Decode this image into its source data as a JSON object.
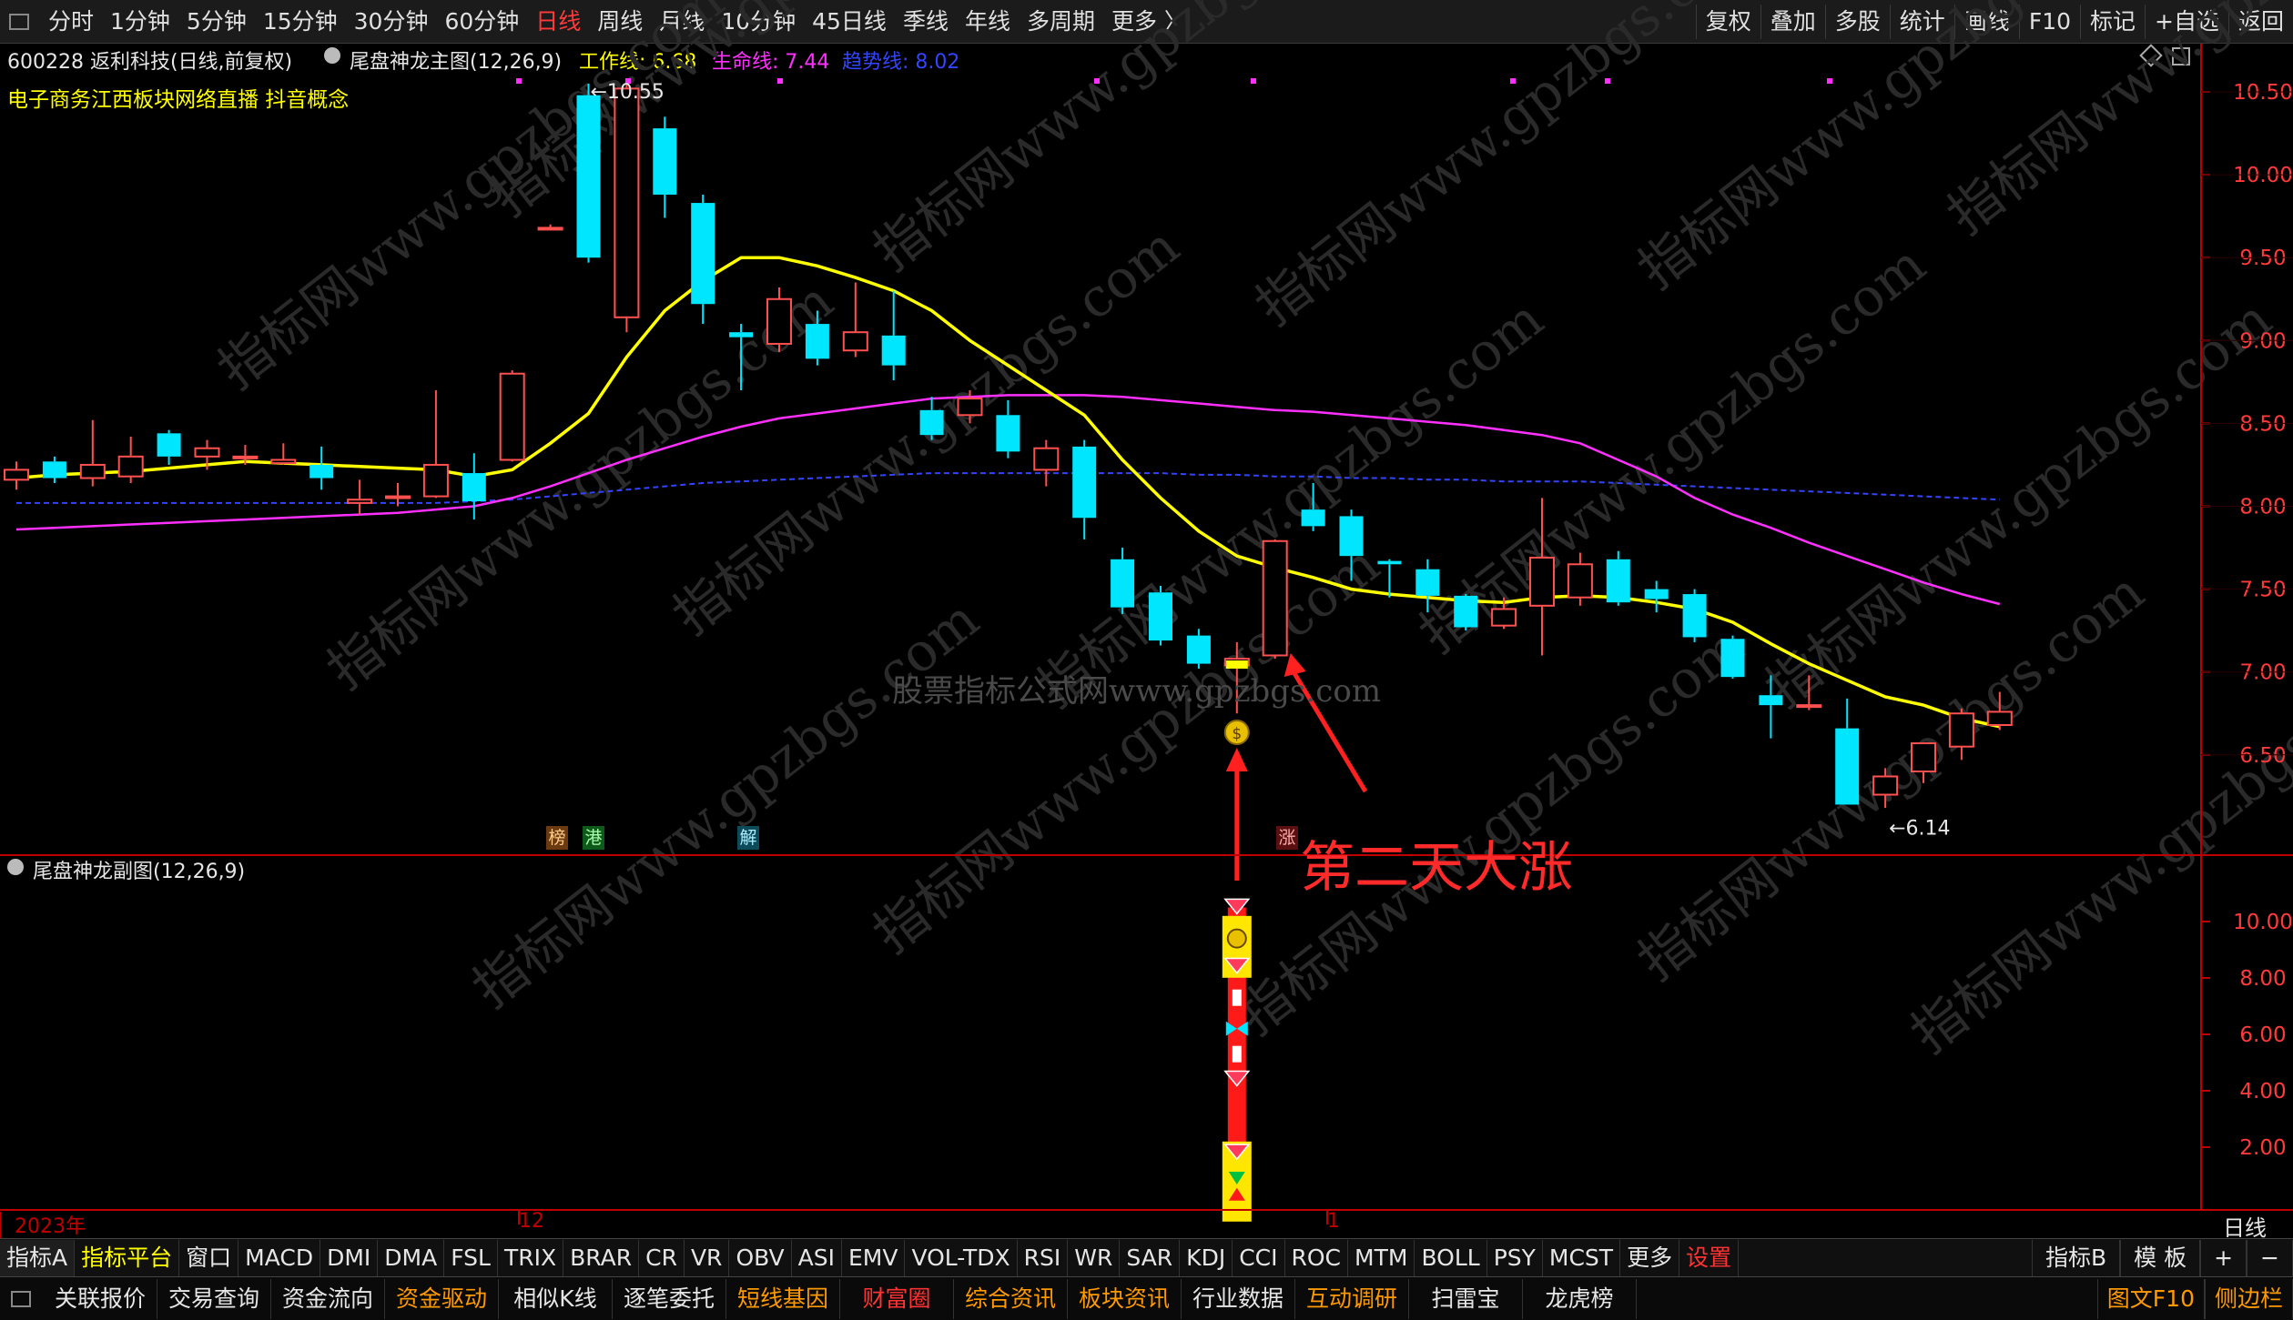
{
  "top_tabs": [
    "分时",
    "1分钟",
    "5分钟",
    "15分钟",
    "30分钟",
    "60分钟",
    "日线",
    "周线",
    "月线",
    "10分钟",
    "45日线",
    "季线",
    "年线",
    "多周期",
    "更多 〉"
  ],
  "top_active": "日线",
  "top_right": [
    "复权",
    "叠加",
    "多股",
    "统计",
    "画线",
    "F10",
    "标记",
    "+自选",
    "返回"
  ],
  "main_header": {
    "stock": "600228 返利科技(日线,前复权)",
    "indicator": "尾盘神龙主图(12,26,9)",
    "work_label": "工作线: 6.68",
    "life_label": "生命线: 7.44",
    "trend_label": "趋势线: 8.02"
  },
  "concepts": "电子商务江西板块网络直播 抖音概念",
  "sub_header": "尾盘神龙副图(12,26,9)",
  "timeline": {
    "year": "2023年",
    "dec": "12",
    "jan": "1",
    "period": "日线"
  },
  "badges": {
    "bang": "榜",
    "gang": "港",
    "jie": "解",
    "zhang": "涨"
  },
  "watermark": "股票指标公式网www.gpzbgs.com",
  "diag_watermark": "指标网www.gpzbgs.com",
  "annotation": "第二天大涨",
  "colors": {
    "up": "#ff5050",
    "down": "#00e6ff",
    "work": "#ffff00",
    "life": "#ff30ff",
    "trend": "#3344ff",
    "axis": "#c00000"
  },
  "chart_data": {
    "type": "candlestick",
    "price_axis": {
      "min": 6.0,
      "max": 10.75,
      "ticks": [
        "10.50",
        "10.00",
        "9.50",
        "9.00",
        "8.50",
        "8.00",
        "7.50",
        "7.00",
        "6.50"
      ]
    },
    "sub_axis": {
      "min": 0,
      "max": 11,
      "ticks": [
        "10.00",
        "8.00",
        "6.00",
        "4.00",
        "2.00"
      ]
    },
    "high_label": "10.55",
    "low_label": "6.14",
    "candles": [
      {
        "o": 8.16,
        "h": 8.27,
        "l": 8.1,
        "c": 8.22
      },
      {
        "o": 8.27,
        "h": 8.3,
        "l": 8.14,
        "c": 8.17
      },
      {
        "o": 8.17,
        "h": 8.52,
        "l": 8.12,
        "c": 8.25
      },
      {
        "o": 8.18,
        "h": 8.42,
        "l": 8.14,
        "c": 8.3
      },
      {
        "o": 8.44,
        "h": 8.46,
        "l": 8.25,
        "c": 8.3
      },
      {
        "o": 8.3,
        "h": 8.4,
        "l": 8.22,
        "c": 8.35
      },
      {
        "o": 8.3,
        "h": 8.37,
        "l": 8.25,
        "c": 8.3
      },
      {
        "o": 8.26,
        "h": 8.38,
        "l": 8.25,
        "c": 8.28
      },
      {
        "o": 8.25,
        "h": 8.36,
        "l": 8.1,
        "c": 8.17
      },
      {
        "o": 8.02,
        "h": 8.16,
        "l": 7.95,
        "c": 8.04
      },
      {
        "o": 8.06,
        "h": 8.14,
        "l": 8.0,
        "c": 8.06
      },
      {
        "o": 8.06,
        "h": 8.7,
        "l": 8.05,
        "c": 8.25
      },
      {
        "o": 8.2,
        "h": 8.32,
        "l": 7.92,
        "c": 8.03
      },
      {
        "o": 8.28,
        "h": 8.82,
        "l": 8.27,
        "c": 8.8
      },
      {
        "o": 9.68,
        "h": 9.7,
        "l": 9.68,
        "c": 9.68
      },
      {
        "o": 10.48,
        "h": 10.55,
        "l": 9.47,
        "c": 9.5
      },
      {
        "o": 9.14,
        "h": 10.55,
        "l": 9.05,
        "c": 10.52
      },
      {
        "o": 10.28,
        "h": 10.35,
        "l": 9.74,
        "c": 9.88
      },
      {
        "o": 9.83,
        "h": 9.88,
        "l": 9.1,
        "c": 9.22
      },
      {
        "o": 9.05,
        "h": 9.1,
        "l": 8.7,
        "c": 9.02
      },
      {
        "o": 8.98,
        "h": 9.32,
        "l": 8.93,
        "c": 9.25
      },
      {
        "o": 9.1,
        "h": 9.18,
        "l": 8.85,
        "c": 8.89
      },
      {
        "o": 8.94,
        "h": 9.35,
        "l": 8.9,
        "c": 9.05
      },
      {
        "o": 9.03,
        "h": 9.3,
        "l": 8.76,
        "c": 8.85
      },
      {
        "o": 8.58,
        "h": 8.66,
        "l": 8.4,
        "c": 8.43
      },
      {
        "o": 8.55,
        "h": 8.7,
        "l": 8.5,
        "c": 8.65
      },
      {
        "o": 8.55,
        "h": 8.64,
        "l": 8.29,
        "c": 8.33
      },
      {
        "o": 8.22,
        "h": 8.4,
        "l": 8.12,
        "c": 8.35
      },
      {
        "o": 8.36,
        "h": 8.4,
        "l": 7.8,
        "c": 7.93
      },
      {
        "o": 7.68,
        "h": 7.75,
        "l": 7.35,
        "c": 7.39
      },
      {
        "o": 7.48,
        "h": 7.52,
        "l": 7.16,
        "c": 7.19
      },
      {
        "o": 7.22,
        "h": 7.26,
        "l": 7.02,
        "c": 7.05
      },
      {
        "o": 7.04,
        "h": 7.18,
        "l": 6.75,
        "c": 7.08
      },
      {
        "o": 7.1,
        "h": 7.8,
        "l": 7.08,
        "c": 7.79
      },
      {
        "o": 7.98,
        "h": 8.14,
        "l": 7.85,
        "c": 7.88
      },
      {
        "o": 7.94,
        "h": 7.98,
        "l": 7.55,
        "c": 7.7
      },
      {
        "o": 7.67,
        "h": 7.68,
        "l": 7.45,
        "c": 7.65
      },
      {
        "o": 7.62,
        "h": 7.68,
        "l": 7.36,
        "c": 7.46
      },
      {
        "o": 7.46,
        "h": 7.47,
        "l": 7.25,
        "c": 7.27
      },
      {
        "o": 7.28,
        "h": 7.45,
        "l": 7.26,
        "c": 7.38
      },
      {
        "o": 7.4,
        "h": 8.05,
        "l": 7.1,
        "c": 7.69
      },
      {
        "o": 7.45,
        "h": 7.72,
        "l": 7.4,
        "c": 7.65
      },
      {
        "o": 7.68,
        "h": 7.73,
        "l": 7.4,
        "c": 7.42
      },
      {
        "o": 7.5,
        "h": 7.55,
        "l": 7.36,
        "c": 7.44
      },
      {
        "o": 7.47,
        "h": 7.5,
        "l": 7.18,
        "c": 7.21
      },
      {
        "o": 7.2,
        "h": 7.22,
        "l": 6.96,
        "c": 6.97
      },
      {
        "o": 6.86,
        "h": 6.98,
        "l": 6.6,
        "c": 6.8
      },
      {
        "o": 6.8,
        "h": 6.98,
        "l": 6.77,
        "c": 6.8
      },
      {
        "o": 6.66,
        "h": 6.84,
        "l": 6.2,
        "c": 6.2
      },
      {
        "o": 6.26,
        "h": 6.42,
        "l": 6.18,
        "c": 6.37
      },
      {
        "o": 6.4,
        "h": 6.57,
        "l": 6.33,
        "c": 6.57
      },
      {
        "o": 6.55,
        "h": 6.78,
        "l": 6.47,
        "c": 6.75
      },
      {
        "o": 6.68,
        "h": 6.88,
        "l": 6.65,
        "c": 6.76
      }
    ],
    "work_line": [
      8.17,
      8.19,
      8.2,
      8.21,
      8.23,
      8.25,
      8.27,
      8.26,
      8.25,
      8.24,
      8.23,
      8.22,
      8.18,
      8.22,
      8.38,
      8.56,
      8.9,
      9.18,
      9.36,
      9.5,
      9.5,
      9.45,
      9.38,
      9.3,
      9.18,
      9.0,
      8.85,
      8.7,
      8.55,
      8.28,
      8.05,
      7.85,
      7.7,
      7.63,
      7.57,
      7.5,
      7.47,
      7.45,
      7.43,
      7.42,
      7.45,
      7.46,
      7.45,
      7.42,
      7.38,
      7.3,
      7.17,
      7.05,
      6.95,
      6.85,
      6.8,
      6.72,
      6.67
    ],
    "life_line": [
      7.86,
      7.87,
      7.88,
      7.89,
      7.9,
      7.91,
      7.92,
      7.93,
      7.94,
      7.95,
      7.96,
      7.98,
      8.0,
      8.05,
      8.12,
      8.2,
      8.28,
      8.35,
      8.42,
      8.48,
      8.53,
      8.56,
      8.59,
      8.62,
      8.65,
      8.66,
      8.67,
      8.67,
      8.67,
      8.66,
      8.64,
      8.62,
      8.6,
      8.58,
      8.57,
      8.55,
      8.53,
      8.51,
      8.49,
      8.46,
      8.43,
      8.38,
      8.28,
      8.18,
      8.05,
      7.95,
      7.87,
      7.78,
      7.7,
      7.62,
      7.54,
      7.47,
      7.41
    ],
    "trend_line": [
      8.02,
      8.02,
      8.02,
      8.02,
      8.02,
      8.02,
      8.02,
      8.02,
      8.02,
      8.02,
      8.02,
      8.02,
      8.03,
      8.04,
      8.06,
      8.08,
      8.1,
      8.12,
      8.14,
      8.15,
      8.16,
      8.17,
      8.18,
      8.19,
      8.2,
      8.2,
      8.2,
      8.2,
      8.2,
      8.2,
      8.2,
      8.19,
      8.19,
      8.18,
      8.18,
      8.17,
      8.17,
      8.16,
      8.16,
      8.15,
      8.15,
      8.15,
      8.14,
      8.13,
      8.12,
      8.11,
      8.1,
      8.09,
      8.08,
      8.07,
      8.06,
      8.05,
      8.04
    ],
    "buy_signal_index": 32,
    "surge_index": 33,
    "sub_stack_index": 32,
    "sub_values": {
      "column_top": 10.5,
      "column_bottom": 0
    }
  },
  "indicator_tabs": [
    "指标A",
    "指标平台",
    "窗口",
    "MACD",
    "DMI",
    "DMA",
    "FSL",
    "TRIX",
    "BRAR",
    "CR",
    "VR",
    "OBV",
    "ASI",
    "EMV",
    "VOL-TDX",
    "RSI",
    "WR",
    "SAR",
    "KDJ",
    "CCI",
    "ROC",
    "MTM",
    "BOLL",
    "PSY",
    "MCST",
    "更多",
    "设置"
  ],
  "indicator_right": [
    "指标B",
    "模 板",
    "+",
    "−"
  ],
  "func_tabs": [
    {
      "label": "关联报价",
      "color": "#e6e6e6"
    },
    {
      "label": "交易查询",
      "color": "#e6e6e6"
    },
    {
      "label": "资金流向",
      "color": "#e6e6e6"
    },
    {
      "label": "资金驱动",
      "color": "#ff9900"
    },
    {
      "label": "相似K线",
      "color": "#e6e6e6"
    },
    {
      "label": "逐笔委托",
      "color": "#e6e6e6"
    },
    {
      "label": "短线基因",
      "color": "#ff9900"
    },
    {
      "label": "财富圈",
      "color": "#ff3333"
    },
    {
      "label": "综合资讯",
      "color": "#ff9900"
    },
    {
      "label": "板块资讯",
      "color": "#ff9900"
    },
    {
      "label": "行业数据",
      "color": "#e6e6e6"
    },
    {
      "label": "互动调研",
      "color": "#ff9900"
    },
    {
      "label": "扫雷宝",
      "color": "#e6e6e6"
    },
    {
      "label": "龙虎榜",
      "color": "#e6e6e6"
    }
  ],
  "func_right": [
    "图文F10",
    "侧边栏"
  ]
}
